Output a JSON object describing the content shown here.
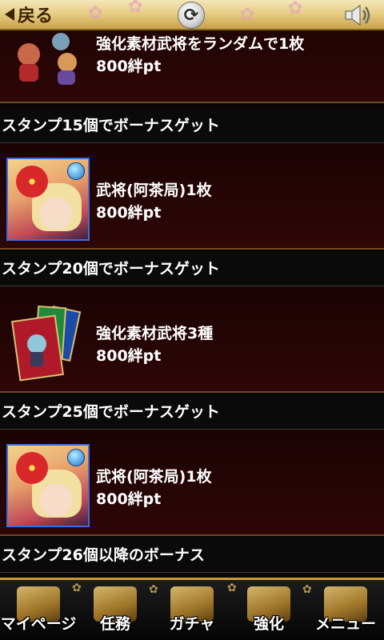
{
  "topbar": {
    "back_label": "戻る"
  },
  "items": [
    {
      "title": "強化素材武将をランダムで1枚",
      "points": "800絆pt"
    },
    {
      "title": "武将(阿茶局)1枚",
      "points": "800絆pt"
    },
    {
      "title": "強化素材武将3種",
      "points": "800絆pt"
    },
    {
      "title": "武将(阿茶局)1枚",
      "points": "800絆pt"
    }
  ],
  "sections": [
    {
      "header": "スタンプ15個でボーナスゲット"
    },
    {
      "header": "スタンプ20個でボーナスゲット"
    },
    {
      "header": "スタンプ25個でボーナスゲット"
    },
    {
      "header": "スタンプ26個以降のボーナス"
    }
  ],
  "bottom_nav": [
    {
      "label": "マイページ",
      "icon": "samurai-helmet-icon"
    },
    {
      "label": "任務",
      "icon": "scroll-icon"
    },
    {
      "label": "ガチャ",
      "icon": "card-icon"
    },
    {
      "label": "強化",
      "icon": "flame-icon"
    },
    {
      "label": "メニュー",
      "icon": "scroll-menu-icon"
    }
  ]
}
